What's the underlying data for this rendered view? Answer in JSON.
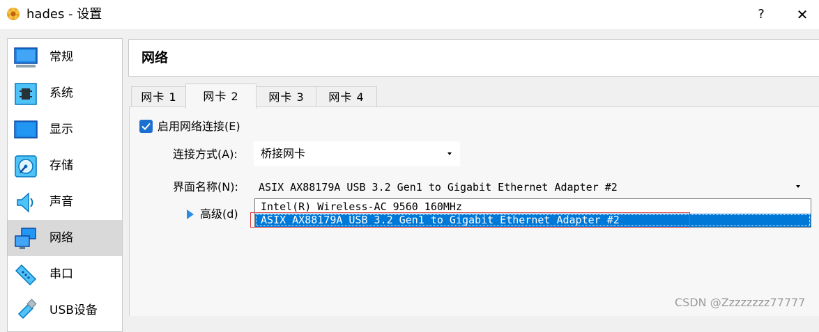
{
  "window": {
    "title": "hades - 设置",
    "help_label": "?",
    "close_label": "✕"
  },
  "sidebar": {
    "items": [
      {
        "label": "常规",
        "icon": "general-icon"
      },
      {
        "label": "系统",
        "icon": "system-icon"
      },
      {
        "label": "显示",
        "icon": "display-icon"
      },
      {
        "label": "存储",
        "icon": "storage-icon"
      },
      {
        "label": "声音",
        "icon": "audio-icon"
      },
      {
        "label": "网络",
        "icon": "network-icon",
        "selected": true
      },
      {
        "label": "串口",
        "icon": "serial-port-icon"
      },
      {
        "label": "USB设备",
        "icon": "usb-icon"
      }
    ]
  },
  "content": {
    "title": "网络",
    "tabs": [
      {
        "label": "网卡 1"
      },
      {
        "label": "网卡 2",
        "active": true
      },
      {
        "label": "网卡 3"
      },
      {
        "label": "网卡 4"
      }
    ],
    "enable_label": "启用网络连接(E)",
    "enable_checked": true,
    "attached_label": "连接方式(A):",
    "attached_value": "桥接网卡",
    "interface_label": "界面名称(N):",
    "interface_value": "ASIX AX88179A USB 3.2 Gen1 to Gigabit Ethernet Adapter #2",
    "advanced_label": "高级(d)",
    "dropdown_options": [
      "Intel(R) Wireless-AC 9560 160MHz",
      "ASIX AX88179A USB 3.2 Gen1 to Gigabit Ethernet Adapter #2"
    ],
    "selected_option_index": 1
  },
  "watermark": "CSDN @Zzzzzzzz77777",
  "colors": {
    "accent": "#0078d7",
    "checkbox": "#1a6fcf",
    "highlight_box": "#e04040"
  }
}
